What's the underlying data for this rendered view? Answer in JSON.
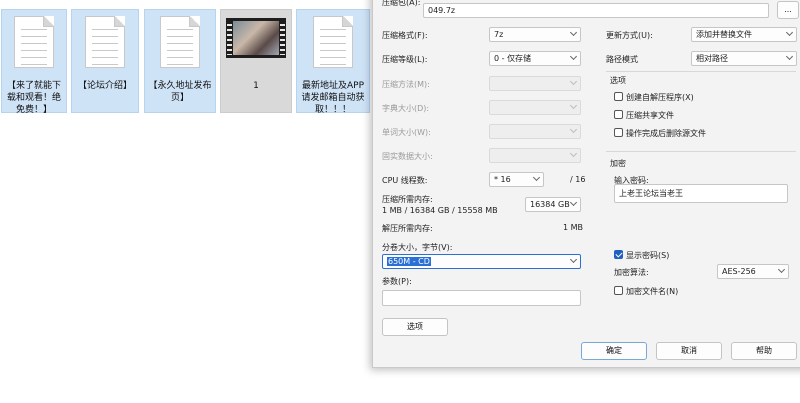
{
  "desktop": {
    "files": [
      {
        "label": "【来了就能下载和观看！绝免费！】",
        "type": "doc"
      },
      {
        "label": "【论坛介绍】",
        "type": "doc"
      },
      {
        "label": "【永久地址发布页】",
        "type": "doc"
      },
      {
        "label": "1",
        "type": "video"
      },
      {
        "label": "最新地址及APP请发邮箱自动获取！！！",
        "type": "doc"
      }
    ]
  },
  "dialog": {
    "archive_label": "压缩包(A):",
    "archive_value": "049.7z",
    "browse_label": "...",
    "format_label": "压缩格式(F):",
    "format_value": "7z",
    "level_label": "压缩等级(L):",
    "level_value": "0 - 仅存储",
    "method_label": "压缩方法(M):",
    "dict_label": "字典大小(D):",
    "word_label": "单词大小(W):",
    "solid_label": "固实数据大小:",
    "cpu_label": "CPU 线程数:",
    "cpu_value": "* 16",
    "cpu_total": "/ 16",
    "mem_label": "压缩所需内存:",
    "mem_detail": "1 MB / 16384 GB / 15558 MB",
    "mem_value": "16384 GB",
    "decomp_label": "解压所需内存:",
    "decomp_value": "1 MB",
    "split_label": "分卷大小，字节(V):",
    "split_value": "650M - CD",
    "params_label": "参数(P):",
    "options_button": "选项",
    "update_label": "更新方式(U):",
    "update_value": "添加并替换文件",
    "path_label": "路径模式",
    "path_value": "相对路径",
    "options_group": "选项",
    "opt_sfx": "创建自解压程序(X)",
    "opt_shared": "压缩共享文件",
    "opt_delete": "操作完成后删除源文件",
    "encrypt_group": "加密",
    "pwd_label": "输入密码:",
    "pwd_value": "上老王论坛当老王",
    "show_pwd": "显示密码(S)",
    "enc_method_label": "加密算法:",
    "enc_method_value": "AES-256",
    "enc_names": "加密文件名(N)",
    "ok": "确定",
    "cancel": "取消",
    "help": "帮助"
  }
}
